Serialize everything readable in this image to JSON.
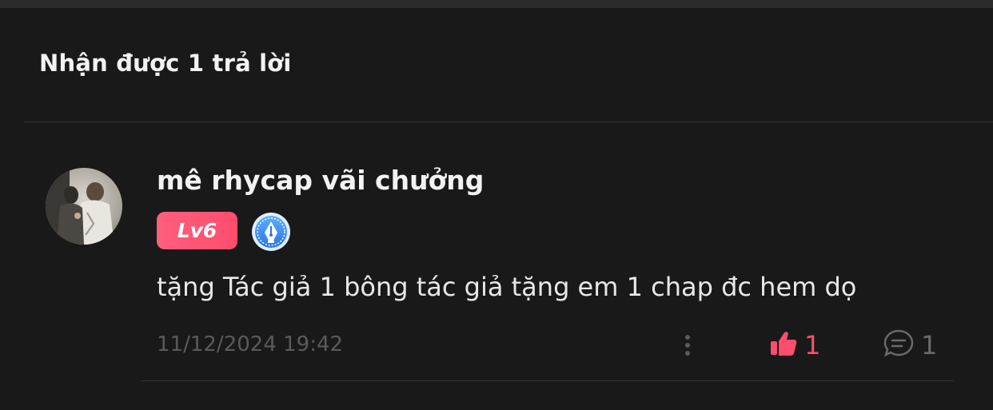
{
  "header": {
    "title": "Nhận được 1 trả lời"
  },
  "comment": {
    "avatar_icon": "user-avatar-photo",
    "username": "mê rhycap vãi chưởng",
    "level_badge": "Lv6",
    "author_badge_icon": "pen-nib-icon",
    "text": "tặng Tác giả 1 bông tác giả tặng em 1 chap đc hem dọ",
    "timestamp": "11/12/2024 19:42",
    "more_icon": "more-vertical-icon",
    "like_icon": "thumbs-up-icon",
    "like_count": "1",
    "reply_icon": "comment-bubble-icon",
    "reply_count": "1"
  },
  "colors": {
    "background": "#191919",
    "accent": "#ff4d6d",
    "badge_blue": "#3b8ff5",
    "muted": "#5a5a5a"
  }
}
